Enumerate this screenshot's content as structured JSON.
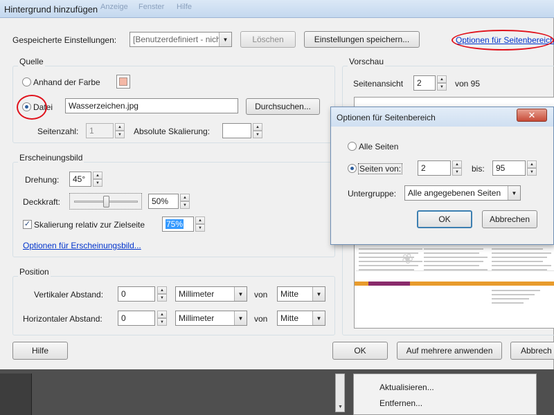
{
  "window": {
    "title": "Hintergrund hinzufügen",
    "ghost_menu": [
      "Anzeige",
      "Fenster",
      "Hilfe"
    ]
  },
  "saved_settings": {
    "label": "Gespeicherte Einstellungen:",
    "value": "[Benutzerdefiniert - nich",
    "delete_label": "Löschen",
    "save_label": "Einstellungen speichern...",
    "page_range_link": "Optionen für Seitenbereich"
  },
  "source": {
    "title": "Quelle",
    "by_color_label": "Anhand der Farbe",
    "color": "#f4b8a6",
    "file_label": "Datei",
    "file_value": "Wasserzeichen.jpg",
    "browse_label": "Durchsuchen...",
    "page_number_label": "Seitenzahl:",
    "page_number_value": "1",
    "absolute_scale_label": "Absolute Skalierung:",
    "absolute_scale_value": ""
  },
  "appearance": {
    "title": "Erscheinungsbild",
    "rotation_label": "Drehung:",
    "rotation_value": "45°",
    "opacity_label": "Deckkraft:",
    "opacity_value": "50%",
    "opacity_level": 0.5,
    "scale_relative_label": "Skalierung relativ zur Zielseite",
    "scale_relative_value": "75%",
    "options_link": "Optionen für Erscheinungsbild..."
  },
  "position": {
    "title": "Position",
    "vertical_label": "Vertikaler Abstand:",
    "vertical_value": "0",
    "vertical_unit": "Millimeter",
    "vertical_from_label": "von",
    "vertical_from": "Mitte",
    "horizontal_label": "Horizontaler Abstand:",
    "horizontal_value": "0",
    "horizontal_unit": "Millimeter",
    "horizontal_from_label": "von",
    "horizontal_from": "Mitte"
  },
  "preview": {
    "title": "Vorschau",
    "page_view_label": "Seitenansicht",
    "page_value": "2",
    "of_label": "von 95"
  },
  "footer": {
    "help_label": "Hilfe",
    "ok_label": "OK",
    "apply_multiple_label": "Auf mehrere anwenden",
    "cancel_label": "Abbrech"
  },
  "page_range_dialog": {
    "title": "Optionen für Seitenbereich",
    "close_glyph": "✕",
    "all_pages_label": "Alle Seiten",
    "pages_from_label": "Seiten von:",
    "from_value": "2",
    "to_label": "bis:",
    "to_value": "95",
    "subset_label": "Untergruppe:",
    "subset_value": "Alle angegebenen Seiten",
    "ok_label": "OK",
    "cancel_label": "Abbrechen"
  },
  "context_menu": {
    "items": [
      "Aktualisieren...",
      "Entfernen..."
    ]
  }
}
